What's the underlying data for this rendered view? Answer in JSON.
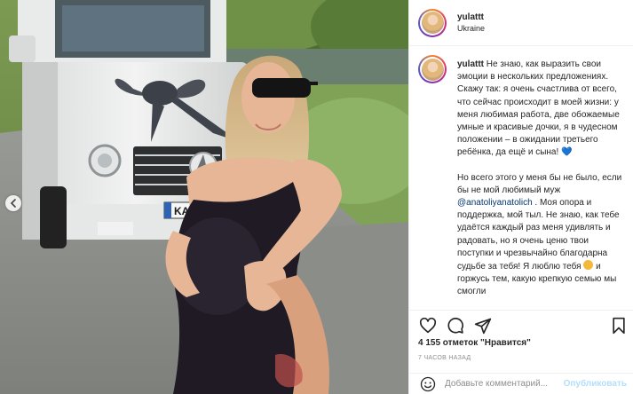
{
  "post": {
    "username": "yulattt",
    "location": "Ukraine",
    "image": {
      "license_plate": "KA"
    },
    "caption": {
      "author": "yulattt",
      "paragraph1": " Не знаю, как выразить свои эмоции в нескольких предложениях. Скажу так: я очень счастлива от всего, что сейчас происходит в моей жизни: у меня любимая работа, две обожаемые умные и красивые дочки, я в чудесном положении – в ожидании третьего ребёнка, да ещё и сына! ",
      "heart_emoji": "💙",
      "paragraph2_before": "Но всего этого у меня бы не было, если бы не мой любимый муж ",
      "mention": "@anatoliyanatolich",
      "paragraph2_after": " . Моя опора и поддержка, мой тыл. Не знаю, как тебе удаётся каждый раз меня удивлять и радовать, но я очень ценю твои поступки и чрезвычайно благодарна судьбе за тебя! Я люблю тебя ",
      "paragraph2_end": " и горжусь тем, какую крепкую семью мы смогли"
    },
    "likes_text": "4 155 отметок \"Нравится\"",
    "time_text": "7 ЧАСОВ НАЗАД",
    "comment_placeholder": "Добавьте комментарий...",
    "publish_label": "Опубликовать",
    "icons": [
      "heart-icon",
      "comment-icon",
      "share-icon",
      "bookmark-icon",
      "emoji-icon",
      "chevron-left-icon"
    ],
    "colors": {
      "accent_link": "#00376b",
      "publish_disabled": "#b2dffc",
      "muted": "#8e8e8e"
    }
  }
}
